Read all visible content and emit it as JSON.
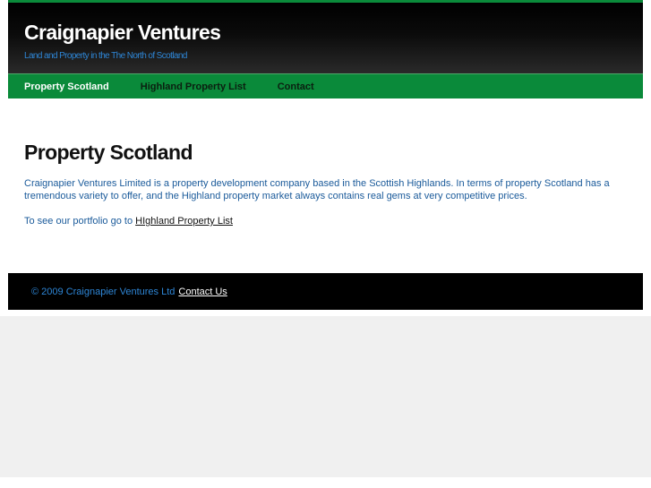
{
  "header": {
    "title": "Craignapier Ventures",
    "tagline": "Land and Property in the The North of Scotland"
  },
  "nav": {
    "items": [
      {
        "label": "Property Scotland",
        "active": true
      },
      {
        "label": "Highland Property List",
        "active": false
      },
      {
        "label": "Contact",
        "active": false
      }
    ]
  },
  "content": {
    "title": "Property Scotland",
    "paragraph1": "Craignapier Ventures Limited is a property development company based in the Scottish Highlands. In terms of property Scotland has a tremendous variety to offer, and the Highland property market always contains real gems at very competitive prices.",
    "paragraph2_prefix": "To see our portfolio go to ",
    "paragraph2_link": "HIghland Property List"
  },
  "footer": {
    "copyright": "© 2009 Craignapier Ventures Ltd",
    "contact_link": "Contact Us"
  },
  "colors": {
    "brand_green": "#0a8a3a",
    "tagline_blue": "#2e86d6",
    "text_blue": "#1a5a9a"
  }
}
